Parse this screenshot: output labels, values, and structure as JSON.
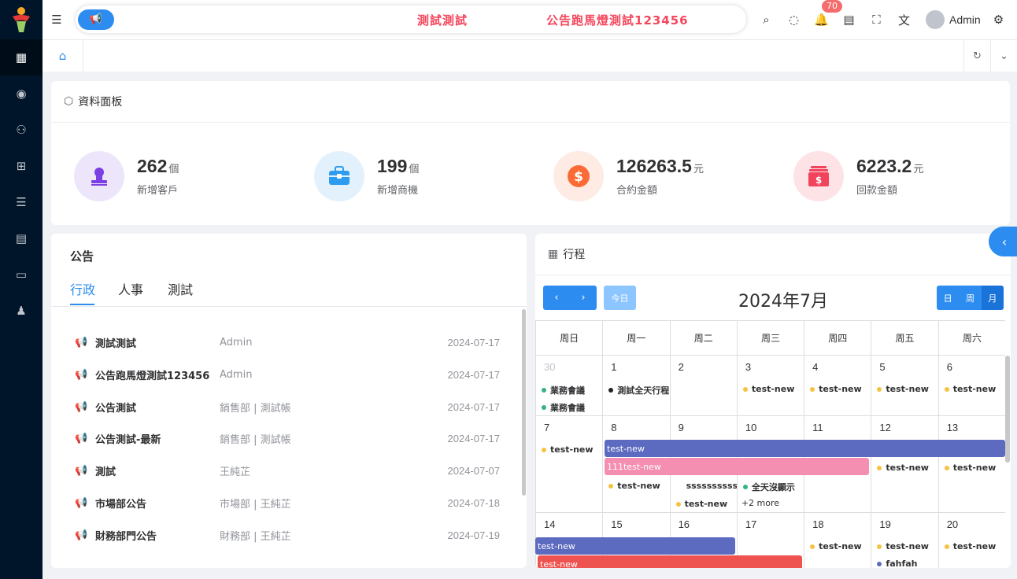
{
  "topbar": {
    "marquee_left": "測試測試",
    "marquee_right": "公告跑馬燈測試123456",
    "notification_count": "70",
    "user": "Admin"
  },
  "dashboard": {
    "title": "資料面板",
    "stats": [
      {
        "value": "262",
        "unit": "個",
        "label": "新增客戶",
        "color": "#7b3fe4",
        "bg": "#ede6fb"
      },
      {
        "value": "199",
        "unit": "個",
        "label": "新增商機",
        "color": "#2d9cf0",
        "bg": "#e3f1fd"
      },
      {
        "value": "126263.5",
        "unit": "元",
        "label": "合約金額",
        "color": "#fb6b36",
        "bg": "#fdebe4"
      },
      {
        "value": "6223.2",
        "unit": "元",
        "label": "回款金額",
        "color": "#f0445c",
        "bg": "#fde3e6"
      }
    ]
  },
  "notice": {
    "title": "公告",
    "tabs": [
      "行政",
      "人事",
      "測試"
    ],
    "rows": [
      {
        "title": "測試測試",
        "by": "Admin",
        "date": "2024-07-17"
      },
      {
        "title": "公告跑馬燈測試123456",
        "by": "Admin",
        "date": "2024-07-17"
      },
      {
        "title": "公告測試",
        "by": "銷售部 | 測試帳",
        "date": "2024-07-17"
      },
      {
        "title": "公告測試-最新",
        "by": "銷售部 | 測試帳",
        "date": "2024-07-17"
      },
      {
        "title": "測試",
        "by": "王純芷",
        "date": "2024-07-07"
      },
      {
        "title": "市場部公告",
        "by": "市場部 | 王純芷",
        "date": "2024-07-18"
      },
      {
        "title": "財務部門公告",
        "by": "財務部 | 王純芷",
        "date": "2024-07-19"
      }
    ]
  },
  "schedule": {
    "title": "行程",
    "prev": "‹",
    "next": "›",
    "today": "今日",
    "month": "2024年7月",
    "views": [
      "日",
      "周",
      "月"
    ],
    "weekdays": [
      "周日",
      "周一",
      "周二",
      "周三",
      "周四",
      "周五",
      "周六"
    ],
    "weeks": [
      [
        "30",
        "1",
        "2",
        "3",
        "4",
        "5",
        "6"
      ],
      [
        "7",
        "8",
        "9",
        "10",
        "11",
        "12",
        "13"
      ],
      [
        "14",
        "15",
        "16",
        "17",
        "18",
        "19",
        "20"
      ]
    ],
    "events": {
      "meeting": "業務會議",
      "allday": "測試全天行程",
      "tn": "test-new",
      "t111": "111test-new",
      "sss": "ssssssssss",
      "noshow": "全天沒顯示",
      "more": "+2 more",
      "fah": "fahfah"
    }
  }
}
